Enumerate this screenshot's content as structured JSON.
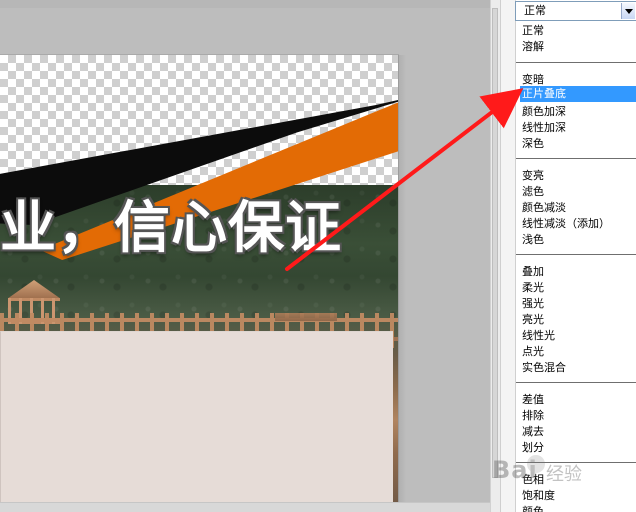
{
  "canvas": {
    "headline": "业，信心保证"
  },
  "panel": {
    "selected_value": "正常",
    "groups": [
      [
        "正常",
        "溶解"
      ],
      [
        "变暗",
        "正片叠底",
        "颜色加深",
        "线性加深",
        "深色"
      ],
      [
        "变亮",
        "滤色",
        "颜色减淡",
        "线性减淡（添加）",
        "浅色"
      ],
      [
        "叠加",
        "柔光",
        "强光",
        "亮光",
        "线性光",
        "点光",
        "实色混合"
      ],
      [
        "差值",
        "排除",
        "减去",
        "划分"
      ],
      [
        "色相",
        "饱和度",
        "颜色"
      ]
    ],
    "highlighted_item": "正片叠底"
  },
  "watermark": {
    "brand": "Bai",
    "product": "经验"
  },
  "colors": {
    "selection": "#3399ff",
    "arrow": "#ff1a1a",
    "ribbon_orange": "#e36b05",
    "ribbon_black": "#0c0c0c"
  }
}
